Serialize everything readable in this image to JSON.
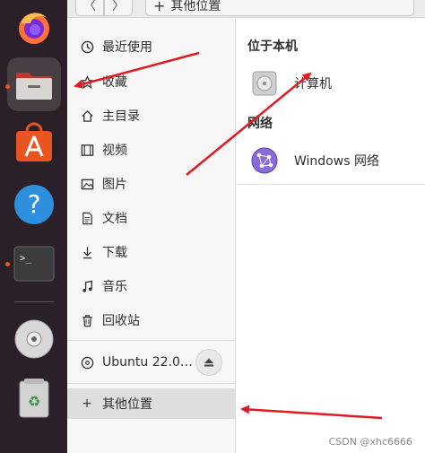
{
  "dock": {
    "apps": [
      {
        "name": "firefox",
        "running": false
      },
      {
        "name": "files",
        "running": true,
        "active": true
      },
      {
        "name": "app-center",
        "running": false
      },
      {
        "name": "help",
        "running": false
      },
      {
        "name": "terminal",
        "running": true
      },
      {
        "name": "disc",
        "running": false
      },
      {
        "name": "trash",
        "running": false
      }
    ]
  },
  "header": {
    "back_label": "〈",
    "forward_label": "〉",
    "path_prefix": "+",
    "path_label": "其他位置"
  },
  "sidebar": {
    "items": [
      {
        "label": "最近使用",
        "icon": "clock-icon"
      },
      {
        "label": "收藏",
        "icon": "star-icon"
      },
      {
        "label": "主目录",
        "icon": "home-icon"
      },
      {
        "label": "视频",
        "icon": "film-icon"
      },
      {
        "label": "图片",
        "icon": "image-icon"
      },
      {
        "label": "文档",
        "icon": "document-icon"
      },
      {
        "label": "下载",
        "icon": "download-icon"
      },
      {
        "label": "音乐",
        "icon": "music-icon"
      },
      {
        "label": "回收站",
        "icon": "trash-icon"
      }
    ],
    "volume_label": "Ubuntu 22.0…",
    "other_locations": {
      "plus": "+",
      "label": "其他位置"
    }
  },
  "content": {
    "section_local": "位于本机",
    "computer_label": "计算机",
    "section_network": "网络",
    "network_label": "Windows 网络"
  },
  "watermark": "CSDN @xhc6666",
  "colors": {
    "dock_bg": "#2b2027",
    "accent": "#e95420",
    "arrow": "#e01b24"
  }
}
